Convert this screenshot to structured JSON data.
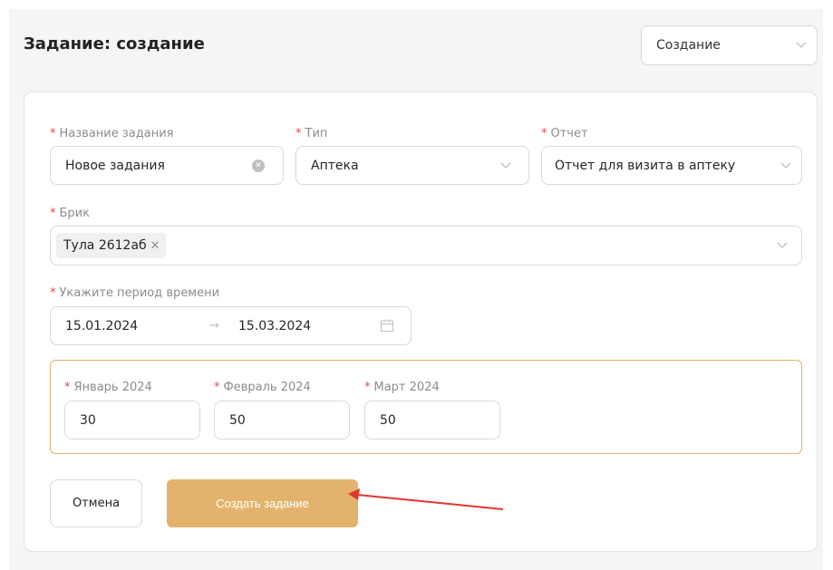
{
  "header": {
    "title": "Задание: создание",
    "mode_select": {
      "value": "Создание",
      "icon": "chevron-down-icon"
    }
  },
  "form": {
    "task_name": {
      "label": "Название задания",
      "value": "Новое задания",
      "required": true
    },
    "type": {
      "label": "Тип",
      "value": "Аптека",
      "required": true
    },
    "report": {
      "label": "Отчет",
      "value": "Отчет для визита в аптеку",
      "required": true
    },
    "brick": {
      "label": "Брик",
      "tags": [
        "Тула 2612аб"
      ],
      "required": true
    },
    "period": {
      "label": "Укажите период времени",
      "start": "15.01.2024",
      "separator": "→",
      "end": "15.03.2024",
      "required": true
    },
    "months": [
      {
        "label": "Январь 2024",
        "value": "30"
      },
      {
        "label": "Февраль 2024",
        "value": "50"
      },
      {
        "label": "Март 2024",
        "value": "50"
      }
    ]
  },
  "actions": {
    "cancel": "Отмена",
    "create": "Создать задание"
  },
  "colors": {
    "accent": "#e3b36d",
    "required": "#e5484d",
    "annotation_arrow": "#e0382f"
  }
}
